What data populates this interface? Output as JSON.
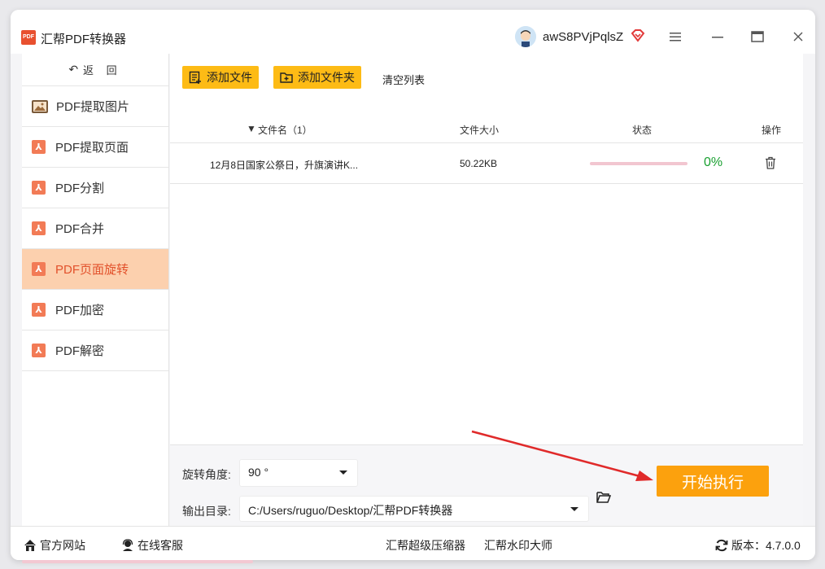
{
  "app": {
    "title": "汇帮PDF转换器",
    "logo_text": "PDF",
    "user_name": "awS8PVjPqlsZ"
  },
  "sidebar": {
    "back_label": "返 回",
    "back_arrow": "↶",
    "items": [
      {
        "label": "PDF提取图片",
        "icon": "image-icon",
        "active": false
      },
      {
        "label": "PDF提取页面",
        "icon": "pdf-icon",
        "active": false
      },
      {
        "label": "PDF分割",
        "icon": "pdf-icon",
        "active": false
      },
      {
        "label": "PDF合并",
        "icon": "pdf-icon",
        "active": false
      },
      {
        "label": "PDF页面旋转",
        "icon": "pdf-icon",
        "active": true
      },
      {
        "label": "PDF加密",
        "icon": "pdf-icon",
        "active": false
      },
      {
        "label": "PDF解密",
        "icon": "pdf-icon",
        "active": false
      }
    ]
  },
  "toolbar": {
    "add_file": "添加文件",
    "add_folder": "添加文件夹",
    "clear_list": "清空列表"
  },
  "table": {
    "headers": {
      "name": "文件名（1）",
      "size": "文件大小",
      "status": "状态",
      "action": "操作"
    },
    "rows": [
      {
        "name": "12月8日国家公祭日，升旗演讲K...",
        "size": "50.22KB",
        "progress": 0,
        "progress_text": "0%"
      }
    ]
  },
  "settings": {
    "rotate_label": "旋转角度:",
    "rotate_value": "90 °",
    "output_label": "输出目录:",
    "output_value": "C:/Users/ruguo/Desktop/汇帮PDF转换器",
    "start_button": "开始执行"
  },
  "footer": {
    "official_site": "官方网站",
    "online_service": "在线客服",
    "compressor": "汇帮超级压缩器",
    "watermark": "汇帮水印大师",
    "version_label": "版本：",
    "version": "4.7.0.0"
  },
  "colors": {
    "accent": "#fdbb15",
    "start": "#fca10d",
    "active_bg": "#fcd0ae",
    "active_text": "#e2512b",
    "progress_text": "#1aa031",
    "annotation_arrow": "#e02a2a"
  }
}
